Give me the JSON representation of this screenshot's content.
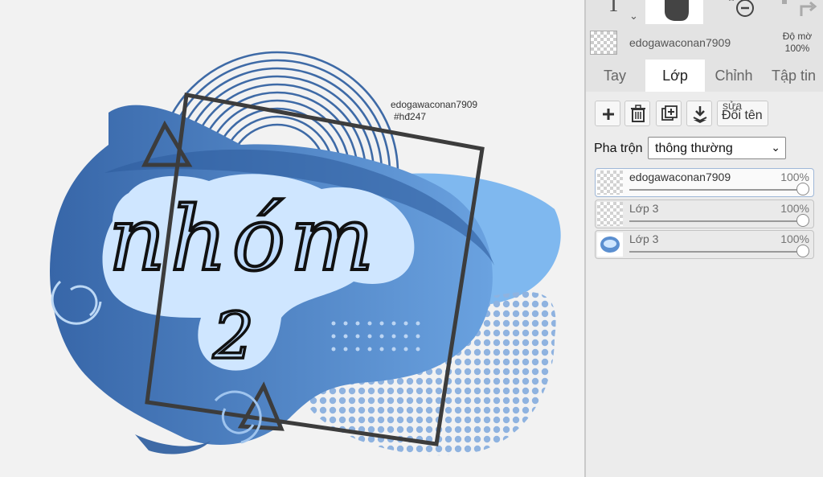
{
  "canvas": {
    "watermark_line1": "edogawaconan7909",
    "watermark_line2": "#hđ247",
    "art_text_line1": "nhóm",
    "art_text_line2": "2"
  },
  "toolbar": {
    "text_tool_glyph": "T",
    "chevron": "⌄",
    "tools": [
      "text-tool",
      "hand-tool",
      "zoom-out-tool",
      "redo-tool"
    ]
  },
  "layer_header": {
    "current_layer_name": "edogawaconan7909",
    "opacity_label": "Độ mờ",
    "opacity_value": "100%"
  },
  "tabs": [
    "Tay",
    "Lớp",
    "Chỉnh",
    "Tập tin"
  ],
  "layer_tools": {
    "add_label": "+",
    "rename_top": "sửa",
    "rename_bottom": "Đổi tên"
  },
  "blend": {
    "label": "Pha trộn",
    "value": "thông thường",
    "chevron": "⌄"
  },
  "layers": [
    {
      "name": "edogawaconan7909",
      "opacity": "100%",
      "active": true,
      "opacity_value": 1.0
    },
    {
      "name": "Lớp 3",
      "opacity": "100%",
      "active": false,
      "opacity_value": 1.0
    },
    {
      "name": "Lớp 3",
      "opacity": "100%",
      "active": false,
      "opacity_value": 1.0
    }
  ],
  "colors": {
    "blob_dark": "#3f6fae",
    "blob_light": "#7fb8ef",
    "cloud": "#cfe6ff",
    "frame": "#3c3c3c",
    "dots": "#8fb3e0"
  }
}
